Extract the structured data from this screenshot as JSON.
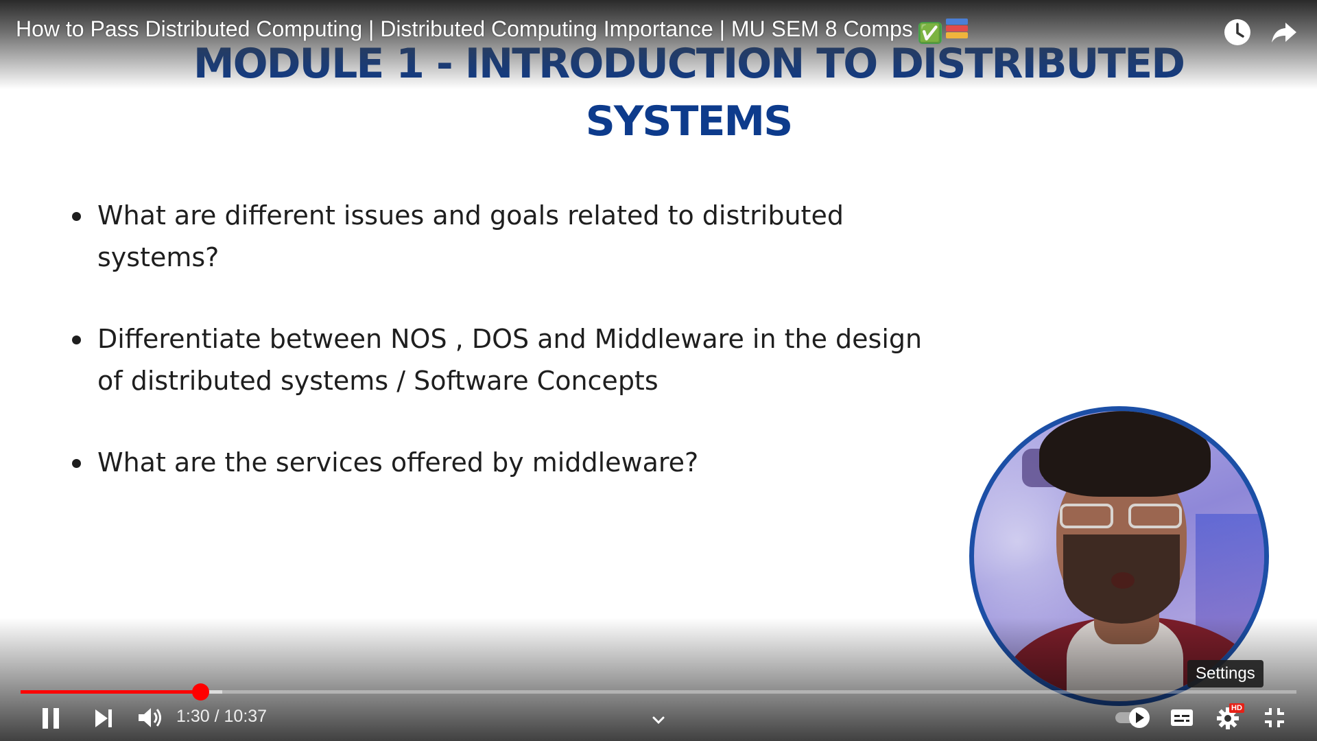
{
  "video": {
    "title": "How to Pass Distributed Computing | Distributed Computing Importance | MU SEM 8 Comps",
    "title_emoji_check": "✅"
  },
  "slide": {
    "heading_line1": "MODULE 1 - INTRODUCTION TO DISTRIBUTED",
    "heading_line2": "SYSTEMS",
    "bullets": [
      "What are different issues and goals related to distributed systems?",
      "Differentiate between NOS , DOS and Middleware in the design of distributed systems / Software Concepts",
      "What are the services offered by middleware?"
    ]
  },
  "player": {
    "current_time": "1:30",
    "separator": " / ",
    "duration": "10:37",
    "progress_fraction": 0.141,
    "buffered_fraction": 0.158,
    "tooltip": "Settings",
    "quality_badge": "HD",
    "accent_color": "#ff0000"
  },
  "icons": {
    "top": [
      "watch-later-icon",
      "share-icon"
    ],
    "controls_left": [
      "pause-icon",
      "next-icon",
      "volume-icon"
    ],
    "controls_center": [
      "chevron-down-icon"
    ],
    "controls_right": [
      "autoplay-toggle-icon",
      "subtitles-icon",
      "settings-icon",
      "exit-fullscreen-icon"
    ]
  }
}
